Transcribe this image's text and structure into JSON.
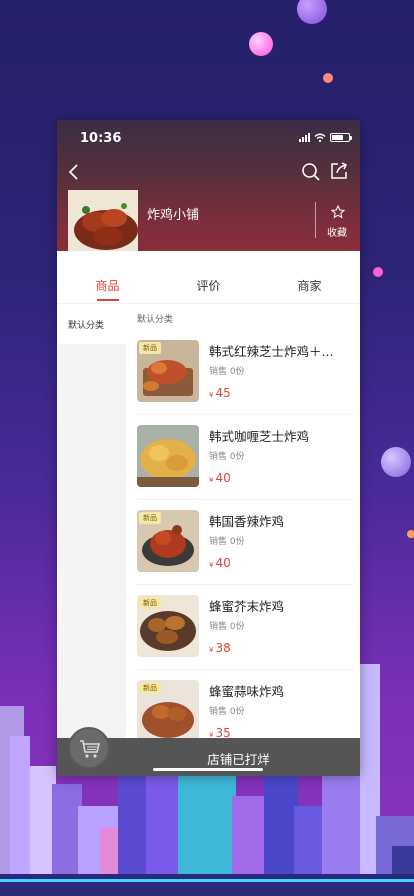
{
  "status_bar": {
    "time": "10:36"
  },
  "shop": {
    "name": "炸鸡小铺",
    "favorite_label": "收藏"
  },
  "tabs": [
    {
      "label": "商品",
      "active": true
    },
    {
      "label": "评价",
      "active": false
    },
    {
      "label": "商家",
      "active": false
    }
  ],
  "sidebar": {
    "items": [
      {
        "label": "默认分类",
        "selected": true
      }
    ]
  },
  "category_title": "默认分类",
  "products": [
    {
      "tag": "新品",
      "name": "韩式红辣芝士炸鸡＋...",
      "sales": "销售 0份",
      "currency": "¥",
      "price": "45"
    },
    {
      "tag": "",
      "name": "韩式咖喱芝士炸鸡",
      "sales": "销售 0份",
      "currency": "¥",
      "price": "40"
    },
    {
      "tag": "新品",
      "name": "韩国香辣炸鸡",
      "sales": "销售 0份",
      "currency": "¥",
      "price": "40"
    },
    {
      "tag": "新品",
      "name": "蜂蜜芥末炸鸡",
      "sales": "销售 0份",
      "currency": "¥",
      "price": "38"
    },
    {
      "tag": "新品",
      "name": "蜂蜜蒜味炸鸡",
      "sales": "销售 0份",
      "currency": "¥",
      "price": "35"
    }
  ],
  "bottom_bar": {
    "status_text": "店铺已打烊"
  },
  "colors": {
    "accent": "#e0443a",
    "hero": "#7a2e3c",
    "bar": "#555555"
  },
  "icons": [
    "back-icon",
    "search-icon",
    "share-icon",
    "star-icon",
    "cart-icon"
  ]
}
